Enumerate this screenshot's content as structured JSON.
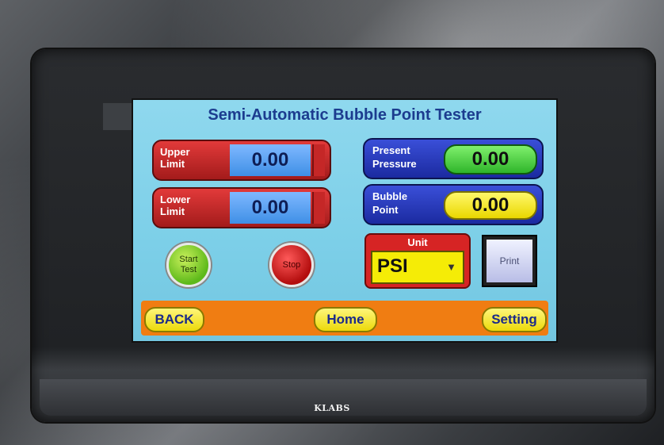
{
  "title": "Semi-Automatic Bubble Point Tester",
  "upper_limit": {
    "label_line1": "Upper",
    "label_line2": "Limit",
    "value": "0.00"
  },
  "lower_limit": {
    "label_line1": "Lower",
    "label_line2": "Limit",
    "value": "0.00"
  },
  "present_pressure": {
    "label_line1": "Present",
    "label_line2": "Pressure",
    "value": "0.00"
  },
  "bubble_point": {
    "label_line1": "Bubble",
    "label_line2": "Point",
    "value": "0.00"
  },
  "start_button": {
    "line1": "Start",
    "line2": "Test"
  },
  "stop_button": {
    "label": "Stop"
  },
  "unit": {
    "title": "Unit",
    "value": "PSI",
    "arrow_icon": "dropdown-arrow-icon"
  },
  "print_button": {
    "label": "Print"
  },
  "nav": {
    "back": "BACK",
    "home": "Home",
    "setting": "Setting"
  },
  "brand": "KLABS",
  "colors": {
    "screen_bg": "#7ccfe8",
    "title": "#1c3c8f",
    "red_panel": "#d62424",
    "blue_panel": "#1b2aa0",
    "nav_bar": "#f07d12",
    "nav_button": "#f5ec06"
  }
}
